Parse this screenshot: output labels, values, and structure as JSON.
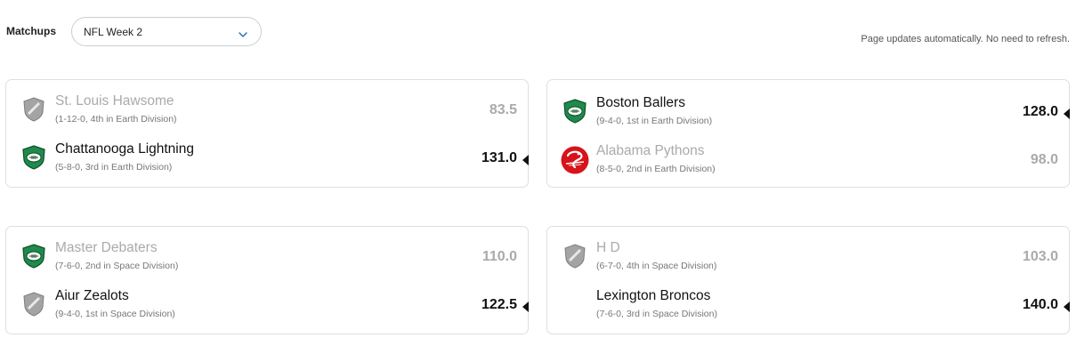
{
  "header": {
    "matchups_label": "Matchups",
    "week_selected": "NFL Week 2",
    "auto_update_note": "Page updates automatically. No need to refresh."
  },
  "colors": {
    "winner_text": "#111111",
    "loser_text": "#aaaaaa",
    "green_helmet": "#1f8a4c",
    "grey_shield": "#9a9a9a",
    "python_red": "#d7141a"
  },
  "matchups": [
    {
      "top": {
        "name": "St. Louis Hawsome",
        "record": "(1-12-0, 4th in Earth Division)",
        "score": "83.5",
        "logo": "grey-shield-icon"
      },
      "bottom": {
        "name": "Chattanooga Lightning",
        "record": "(5-8-0, 3rd in Earth Division)",
        "score": "131.0",
        "logo": "green-helmet-icon"
      }
    },
    {
      "top": {
        "name": "Boston Ballers",
        "record": "(9-4-0, 1st in Earth Division)",
        "score": "128.0",
        "logo": "green-helmet-icon"
      },
      "bottom": {
        "name": "Alabama Pythons",
        "record": "(8-5-0, 2nd in Earth Division)",
        "score": "98.0",
        "logo": "python-logo-icon"
      }
    },
    {
      "top": {
        "name": "Master Debaters",
        "record": "(7-6-0, 2nd in Space Division)",
        "score": "110.0",
        "logo": "green-helmet-icon"
      },
      "bottom": {
        "name": "Aiur Zealots",
        "record": "(9-4-0, 1st in Space Division)",
        "score": "122.5",
        "logo": "grey-shield-icon"
      }
    },
    {
      "top": {
        "name": "H D",
        "record": "(6-7-0, 4th in Space Division)",
        "score": "103.0",
        "logo": "grey-shield-icon"
      },
      "bottom": {
        "name": "Lexington Broncos",
        "record": "(7-6-0, 3rd in Space Division)",
        "score": "140.0",
        "logo": ""
      }
    }
  ]
}
